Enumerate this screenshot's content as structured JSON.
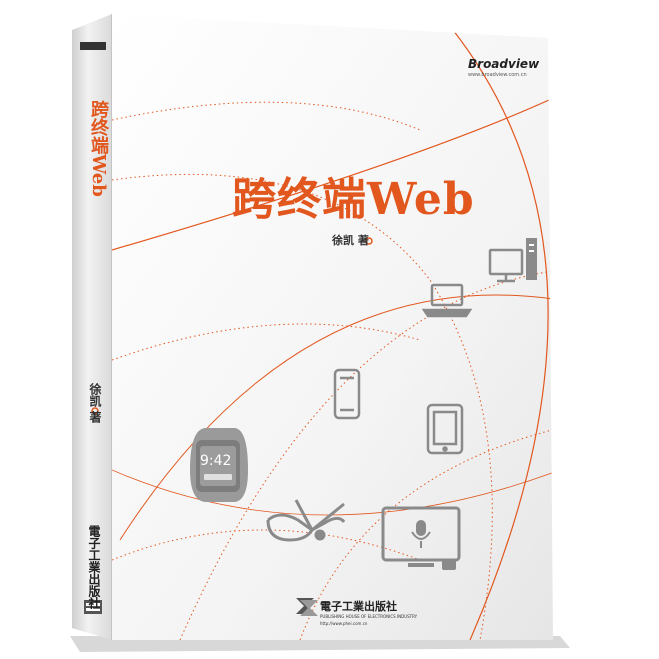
{
  "cover": {
    "title": "跨终端Web",
    "author": "徐凯 著",
    "brand": "Broadview",
    "brand_url": "www.broadview.com.cn",
    "watch_time": "9:42"
  },
  "spine": {
    "title": "跨终端Web",
    "author": "徐凯 著",
    "publisher": "電子工業出版社"
  },
  "publisher": {
    "name": "電子工業出版社",
    "name_en": "PUBLISHING HOUSE OF ELECTRONICS INDUSTRY",
    "url": "http://www.phei.com.cn"
  },
  "colors": {
    "accent": "#e2571e",
    "icon_gray": "#8a8a8a",
    "cover": "#f6f6f6",
    "spine": "#e9e9e9"
  },
  "icons": [
    "desktop-monitor-icon",
    "laptop-icon",
    "smartphone-icon",
    "tablet-icon",
    "smartwatch-icon",
    "smart-glasses-icon",
    "smart-tv-icon",
    "publisher-logo-icon"
  ]
}
